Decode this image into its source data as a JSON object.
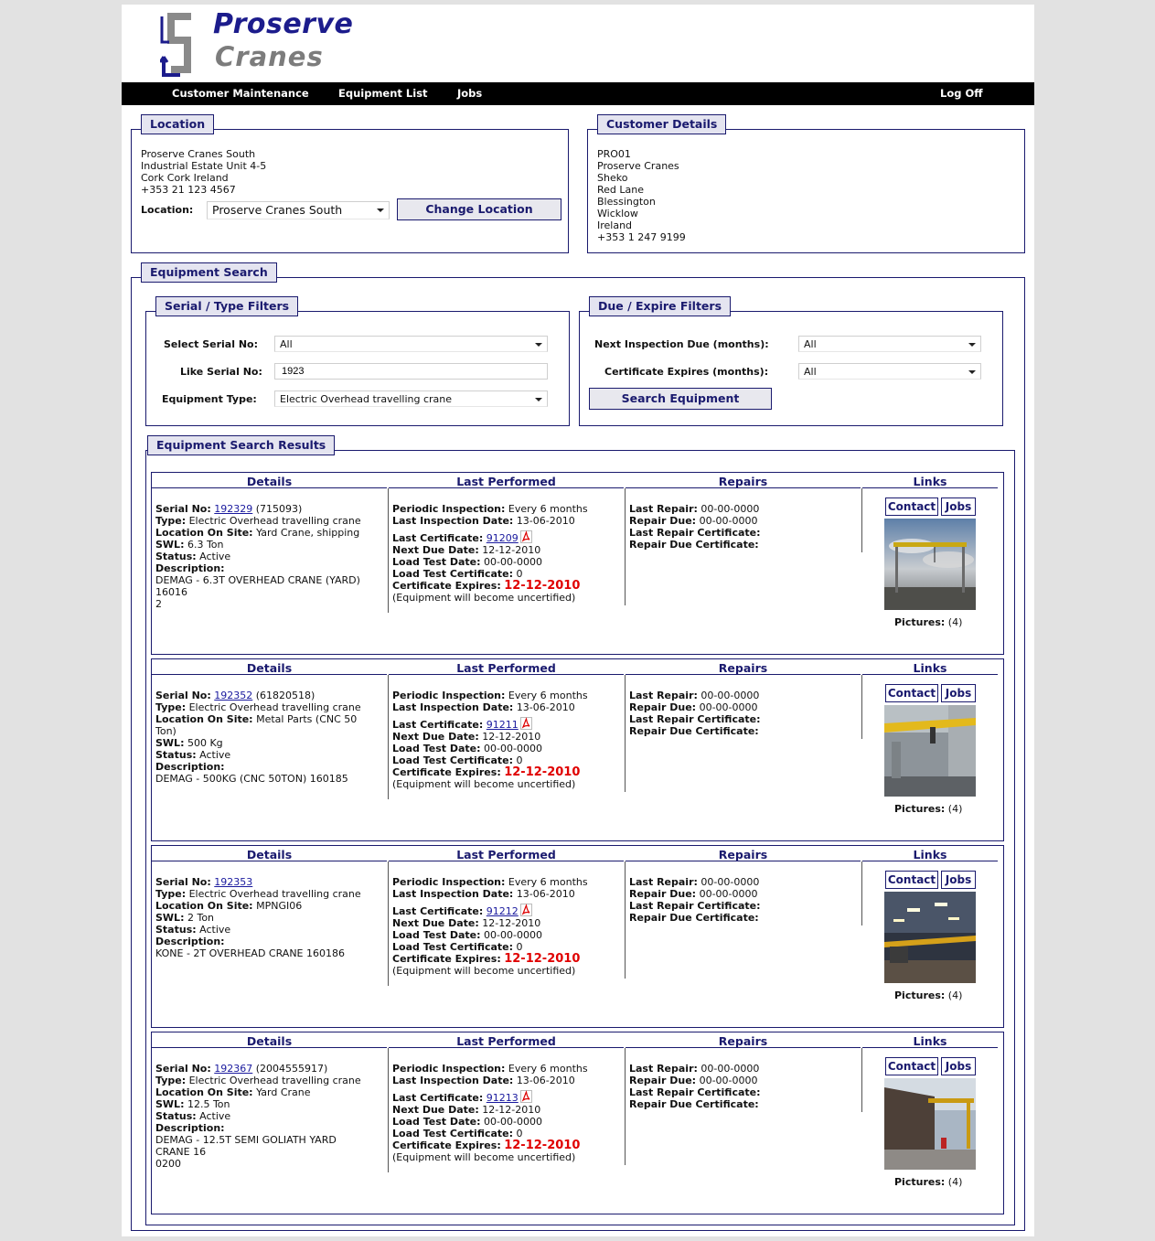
{
  "brand": {
    "line1": "Proserve",
    "line2": "Cranes"
  },
  "nav": {
    "customer_maintenance": "Customer Maintenance",
    "equipment_list": "Equipment List",
    "jobs": "Jobs",
    "log_off": "Log Off"
  },
  "location": {
    "legend": "Location",
    "address": [
      "Proserve Cranes South",
      "Industrial Estate Unit 4-5",
      "Cork Cork Ireland",
      "+353 21 123 4567"
    ],
    "select_label": "Location:",
    "selected": "Proserve Cranes South",
    "change_button": "Change Location"
  },
  "customer": {
    "legend": "Customer Details",
    "lines": [
      "PRO01",
      "Proserve Cranes",
      "Sheko",
      "Red Lane",
      "Blessington",
      "Wicklow",
      "Ireland",
      "+353 1 247 9199"
    ]
  },
  "search": {
    "legend": "Equipment Search",
    "serial_legend": "Serial / Type Filters",
    "select_serial_label": "Select Serial No:",
    "select_serial_value": "All",
    "like_serial_label": "Like Serial No:",
    "like_serial_value": "1923",
    "equipment_type_label": "Equipment Type:",
    "equipment_type_value": "Electric Overhead travelling crane",
    "due_legend": "Due / Expire Filters",
    "next_due_label": "Next Inspection Due (months):",
    "next_due_value": "All",
    "cert_expires_label": "Certificate Expires (months):",
    "cert_expires_value": "All",
    "search_button": "Search Equipment"
  },
  "results": {
    "legend": "Equipment Search Results",
    "headers": {
      "details": "Details",
      "last_performed": "Last Performed",
      "repairs": "Repairs",
      "links": "Links"
    },
    "labels": {
      "serial": "Serial No:",
      "type": "Type:",
      "location": "Location On Site:",
      "swl": "SWL:",
      "status": "Status:",
      "description": "Description:",
      "periodic": "Periodic Inspection:",
      "last_inspection": "Last Inspection Date:",
      "last_certificate": "Last Certificate:",
      "next_due": "Next Due Date:",
      "load_test_date": "Load Test Date:",
      "load_test_cert": "Load Test Certificate:",
      "cert_expires": "Certificate Expires:",
      "last_repair": "Last Repair:",
      "repair_due": "Repair Due:",
      "last_repair_cert": "Last Repair Certificate:",
      "repair_due_cert": "Repair Due Certificate:",
      "contact": "Contact",
      "jobs": "Jobs",
      "pictures": "Pictures:"
    },
    "items": [
      {
        "serial": "192329",
        "serial_extra": " (715093)",
        "type": "Electric Overhead travelling crane",
        "location_lines": [
          "Yard Crane, shipping"
        ],
        "swl": "6.3 Ton",
        "status": "Active",
        "description_lines": [
          "DEMAG - 6.3T OVERHEAD CRANE (YARD)",
          "16016",
          "2"
        ],
        "periodic": "Every 6 months",
        "last_inspection": "13-06-2010",
        "last_certificate": "91209",
        "next_due": "12-12-2010",
        "load_test_date": "00-00-0000",
        "load_test_cert": "0",
        "cert_expires": "12-12-2010",
        "uncertified_note": "(Equipment will become uncertified)",
        "last_repair": "00-00-0000",
        "repair_due": "00-00-0000",
        "pictures": "(4)",
        "photo": "sky-yard"
      },
      {
        "serial": "192352",
        "serial_extra": " (61820518)",
        "type": "Electric Overhead travelling crane",
        "location_lines": [
          "Metal Parts (CNC 50",
          "Ton)"
        ],
        "swl": "500 Kg",
        "status": "Active",
        "description_lines": [
          "DEMAG - 500KG (CNC 50TON) 160185"
        ],
        "periodic": "Every 6 months",
        "last_inspection": "13-06-2010",
        "last_certificate": "91211",
        "next_due": "12-12-2010",
        "load_test_date": "00-00-0000",
        "load_test_cert": "0",
        "cert_expires": "12-12-2010",
        "uncertified_note": "(Equipment will become uncertified)",
        "last_repair": "00-00-0000",
        "repair_due": "00-00-0000",
        "pictures": "(4)",
        "photo": "workshop-yellow"
      },
      {
        "serial": "192353",
        "serial_extra": "",
        "type": "Electric Overhead travelling crane",
        "location_lines": [
          "MPNGI06"
        ],
        "swl": "2 Ton",
        "status": "Active",
        "description_lines": [
          "KONE - 2T OVERHEAD CRANE 160186"
        ],
        "periodic": "Every 6 months",
        "last_inspection": "13-06-2010",
        "last_certificate": "91212",
        "next_due": "12-12-2010",
        "load_test_date": "00-00-0000",
        "load_test_cert": "0",
        "cert_expires": "12-12-2010",
        "uncertified_note": "(Equipment will become uncertified)",
        "last_repair": "00-00-0000",
        "repair_due": "00-00-0000",
        "pictures": "(4)",
        "photo": "factory-lights"
      },
      {
        "serial": "192367",
        "serial_extra": " (2004555917)",
        "type": "Electric Overhead travelling crane",
        "location_lines": [
          "Yard Crane"
        ],
        "swl": "12.5 Ton",
        "status": "Active",
        "description_lines": [
          "DEMAG - 12.5T SEMI GOLIATH YARD",
          "CRANE 16",
          "0200"
        ],
        "periodic": "Every 6 months",
        "last_inspection": "13-06-2010",
        "last_certificate": "91213",
        "next_due": "12-12-2010",
        "load_test_date": "00-00-0000",
        "load_test_cert": "0",
        "cert_expires": "12-12-2010",
        "uncertified_note": "(Equipment will become uncertified)",
        "last_repair": "00-00-0000",
        "repair_due": "00-00-0000",
        "pictures": "(4)",
        "photo": "goliath"
      }
    ]
  },
  "colors": {
    "navy": "#1a1a6e",
    "legend_bg": "#e4e4f0",
    "expiry_red": "#e00000",
    "navbar": "#000000",
    "logo_blue": "#1c1c8c",
    "logo_grey": "#7c7c7c"
  }
}
